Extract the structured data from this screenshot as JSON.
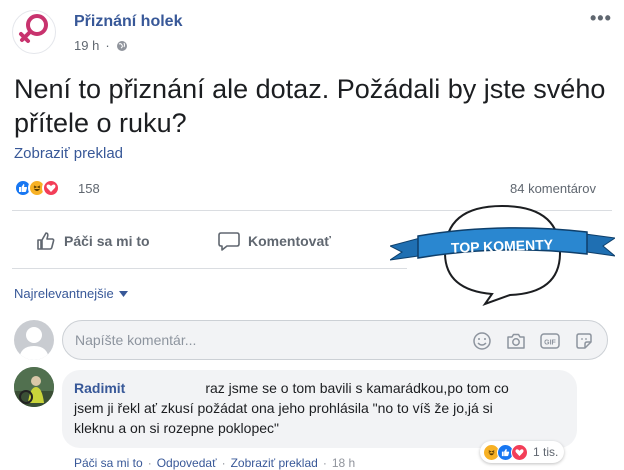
{
  "post": {
    "page_name": "Přiznání holek",
    "time": "19 h",
    "privacy_icon": "globe-icon",
    "text": "Není to přiznání ale dotaz. Požádali by jste svého přítele o ruku?",
    "translate": "Zobraziť preklad",
    "reaction_count": "158",
    "comment_count": "84 komentárov",
    "reactions": [
      "like",
      "haha",
      "love"
    ]
  },
  "actions": {
    "like": "Páči sa mi to",
    "comment": "Komentovať"
  },
  "badge": {
    "text": "TOP KOMENTY"
  },
  "comments_section": {
    "sort": "Najrelevantnejšie",
    "input_placeholder": "Napíšte komentár..."
  },
  "comment": {
    "author": "Radimit",
    "text_line1": "raz jsme se o tom bavili s kamarádkou,po tom co",
    "text_line2": "jsem ji řekl ať zkusí požádat ona jeho prohlásila \"no to víš že jo,já si",
    "text_line3": "kleknu a on si rozepne poklopec\"",
    "reaction_count": "1 tis.",
    "like": "Páči sa mi to",
    "reply": "Odpovedať",
    "translate": "Zobraziť preklad",
    "time": "18 h"
  },
  "colors": {
    "link_blue": "#385898",
    "brand_pink": "#c8336e",
    "badge_ribbon": "#1f6fb2"
  }
}
